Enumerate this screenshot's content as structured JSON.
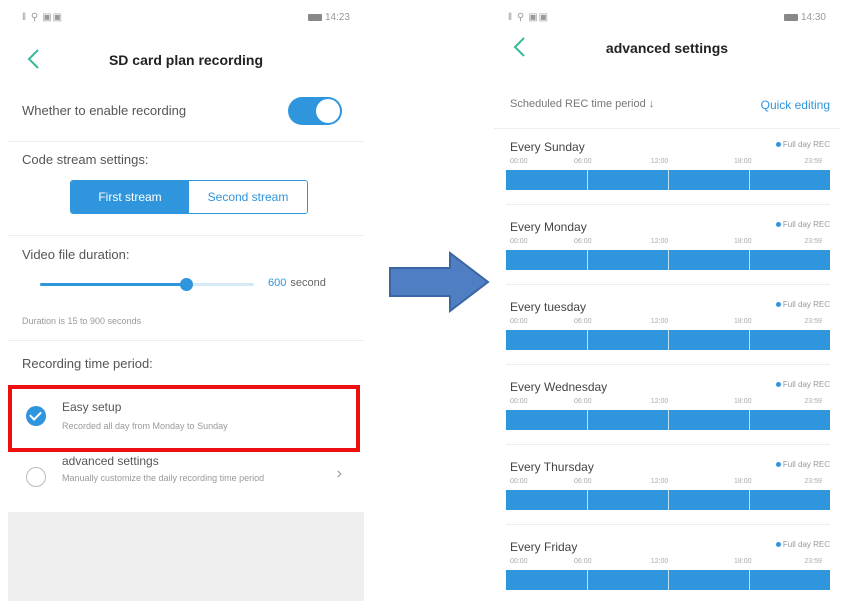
{
  "left": {
    "status_left": "‖ ⚲ ▣▣",
    "status_right_time": "14:23",
    "title": "SD card plan recording",
    "enable_recording_label": "Whether to enable recording",
    "enable_recording_on": true,
    "code_stream_label": "Code stream settings:",
    "stream_first": "First stream",
    "stream_second": "Second stream",
    "video_duration_label": "Video file duration:",
    "video_duration_value": "600",
    "video_duration_unit": "second",
    "video_duration_fraction": 0.68,
    "duration_hint": "Duration is 15 to 900 seconds",
    "period_label": "Recording time period:",
    "easy_setup_title": "Easy setup",
    "easy_setup_desc": "Recorded all day from Monday to Sunday",
    "advanced_title": "advanced settings",
    "advanced_desc": "Manually customize the daily recording time period",
    "chevron": "›",
    "icons": [
      "back-arrow-icon",
      "checkmark-icon",
      "radio-empty-icon",
      "chevron-right-icon"
    ]
  },
  "right": {
    "status_left": "‖ ⚲ ▣▣",
    "status_right_time": "14:30",
    "title": "advanced settings",
    "scheduled_label": "Scheduled REC time period ↓",
    "quick_editing": "Quick editing",
    "full_day_label": "Full day REC",
    "times": [
      "00:00",
      "06:00",
      "12:00",
      "18:00",
      "23:59"
    ],
    "days": [
      {
        "name": "Every Sunday"
      },
      {
        "name": "Every Monday"
      },
      {
        "name": "Every tuesday"
      },
      {
        "name": "Every Wednesday"
      },
      {
        "name": "Every Thursday"
      },
      {
        "name": "Every Friday"
      }
    ]
  },
  "colors": {
    "accent": "#2f95dc",
    "highlight": "#ee1010",
    "arrow": "#4f7fc2"
  }
}
